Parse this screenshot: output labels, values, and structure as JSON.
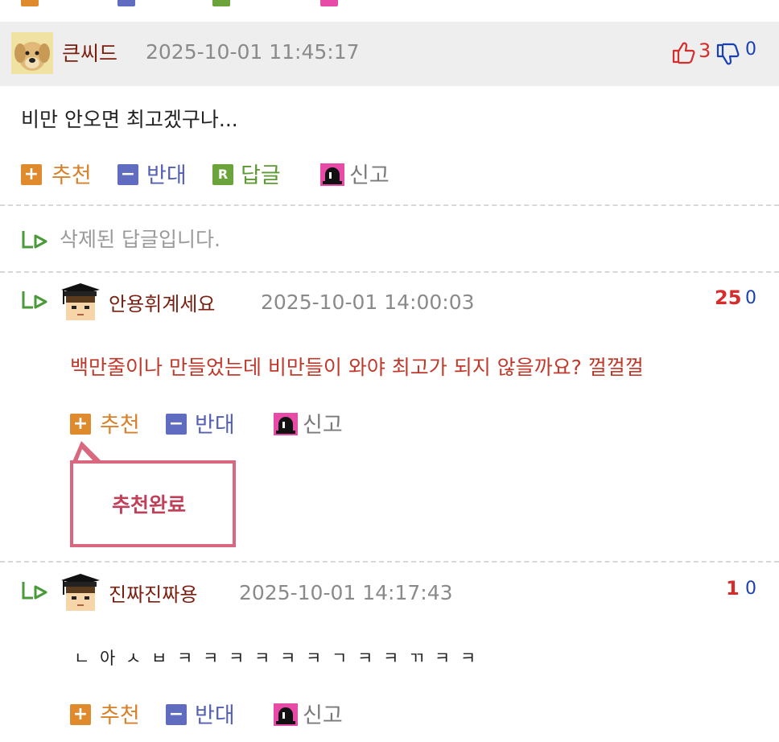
{
  "colors": {
    "nick": "#7a1e10",
    "up": "#d62c2c",
    "down": "#1a3fb0",
    "recommend": "#d9802a",
    "oppose": "#5560b5",
    "reply": "#5d9a33",
    "report": "#7a7a7a",
    "red_content": "#c0392b",
    "popup_border": "#d9677e"
  },
  "comments": [
    {
      "nickname": "큰씨드",
      "datetime": "2025-10-01 11:45:17",
      "up_count": "3",
      "down_count": "0",
      "body": "비만 안오면 최고겠구나...",
      "actions": {
        "recommend": "추천",
        "oppose": "반대",
        "reply": "답글",
        "report": "신고",
        "reply_icon": "R"
      }
    }
  ],
  "deleted_reply": "삭제된 답글입니다.",
  "replies": [
    {
      "nickname": "안용휘계세요",
      "datetime": "2025-10-01 14:00:03",
      "up_count": "25",
      "down_count": "0",
      "body": "백만줄이나 만들었는데 비만들이 와야 최고가 되지 않을까요? 껄껄껄",
      "actions": {
        "recommend": "추천",
        "oppose": "반대",
        "report": "신고"
      },
      "popup": "추천완료"
    },
    {
      "nickname": "진짜진짜용",
      "datetime": "2025-10-01 14:17:43",
      "up_count": "1",
      "down_count": "0",
      "body": "ㄴ 아 ㅅ ㅂ ㅋ ㅋ ㅋ ㅋ ㅋ ㅋ ㄱ ㅋ ㅋ ㄲ ㅋ ㅋ",
      "actions": {
        "recommend": "추천",
        "oppose": "반대",
        "report": "신고"
      }
    }
  ]
}
